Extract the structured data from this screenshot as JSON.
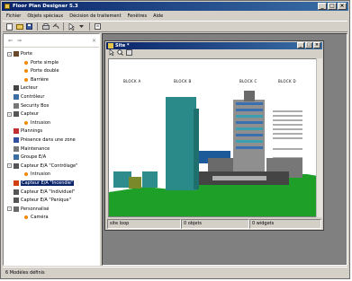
{
  "app": {
    "title": "Floor Plan Designer 5.3",
    "window_buttons": [
      "_",
      "□",
      "×"
    ]
  },
  "menu": [
    "Fichier",
    "Objets spéciaux",
    "Décision de traitement",
    "Fenêtres",
    "Aide"
  ],
  "tree": {
    "header_icons": [
      "back-icon",
      "forward-icon"
    ],
    "nodes": [
      {
        "label": "Porte",
        "level": 0,
        "expander": "-",
        "icon": "door-icon"
      },
      {
        "label": "Porte simple",
        "level": 1,
        "icon": "orange-dot-icon"
      },
      {
        "label": "Porte double",
        "level": 1,
        "icon": "orange-dot-icon"
      },
      {
        "label": "Barrière",
        "level": 1,
        "icon": "orange-dot-icon"
      },
      {
        "label": "Lecteur",
        "level": 0,
        "icon": "reader-icon"
      },
      {
        "label": "Contrôleur",
        "level": 0,
        "icon": "controller-icon"
      },
      {
        "label": "Security Box",
        "level": 0,
        "icon": "box-icon"
      },
      {
        "label": "Capteur",
        "level": 0,
        "expander": "-",
        "icon": "sensor-icon"
      },
      {
        "label": "Intrusion",
        "level": 1,
        "icon": "orange-dot-icon"
      },
      {
        "label": "Plannings",
        "level": 0,
        "icon": "calendar-icon"
      },
      {
        "label": "Présence dans une zone",
        "level": 0,
        "icon": "zone-icon"
      },
      {
        "label": "Maintenance",
        "level": 0,
        "icon": "maintenance-icon"
      },
      {
        "label": "Groupe E/A",
        "level": 0,
        "icon": "group-icon"
      },
      {
        "label": "Capteur E/A \"Contrôlage\"",
        "level": 0,
        "expander": "-",
        "icon": "sensor-ea-icon"
      },
      {
        "label": "Intrusion",
        "level": 1,
        "icon": "orange-dot-icon"
      },
      {
        "label": "Capteur E/A \"Incendie\"",
        "level": 0,
        "icon": "fire-icon",
        "selected": true
      },
      {
        "label": "Capteur E/A \"Individuel\"",
        "level": 0,
        "icon": "sensor-ea-icon"
      },
      {
        "label": "Capteur E/A \"Panique\"",
        "level": 0,
        "icon": "sensor-ea-icon"
      },
      {
        "label": "Personnalisé",
        "level": 0,
        "expander": "-",
        "icon": "custom-icon"
      },
      {
        "label": "Caméra",
        "level": 1,
        "icon": "orange-dot-icon"
      }
    ]
  },
  "status_bar": "6 Modèles définis",
  "child_window": {
    "title": "Site *",
    "blocks": [
      "BLOCK A",
      "BLOCK B",
      "BLOCK C",
      "BLOCK D"
    ],
    "status": [
      "site loop",
      "0 objets",
      "0 widgets"
    ]
  },
  "colors": {
    "title_start": "#0a246a",
    "title_end": "#3a6ea5",
    "grass": "#1ea028",
    "teal": "#2a8a8a",
    "olive": "#7a8a2a",
    "gray_building": "#8f8f8f"
  }
}
